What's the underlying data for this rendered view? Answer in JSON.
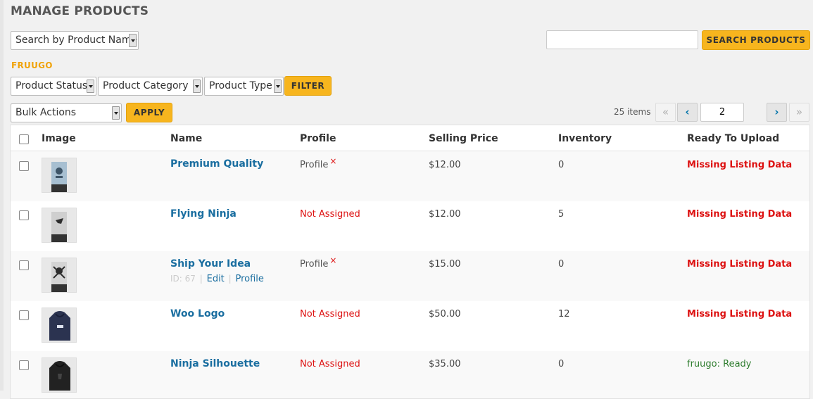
{
  "page": {
    "title": "MANAGE PRODUCTS"
  },
  "search": {
    "filter_by_label": "Search by Product Name",
    "input_value": "",
    "input_placeholder": "",
    "button_label": "SEARCH PRODUCTS"
  },
  "marketplace": "FRUUGO",
  "filters": {
    "status_label": "Product Status",
    "category_label": "Product Category",
    "type_label": "Product Type",
    "button_label": "FILTER"
  },
  "bulk": {
    "label": "Bulk Actions",
    "button_label": "APPLY"
  },
  "pagination": {
    "items_text": "25 items",
    "first": "«",
    "prev": "‹",
    "current_page": "2",
    "next": "›",
    "last": "»"
  },
  "table": {
    "columns": [
      "Image",
      "Name",
      "Profile",
      "Selling Price",
      "Inventory",
      "Ready To Upload"
    ],
    "rows": [
      {
        "name": "Premium Quality",
        "profile": "Profile",
        "profile_x": "×",
        "price": "$12.00",
        "inventory": "0",
        "status": "Missing Listing Data",
        "thumb_icon": "poster-icon"
      },
      {
        "name": "Flying Ninja",
        "profile": "Not Assigned",
        "price": "$12.00",
        "inventory": "5",
        "status": "Missing Listing Data",
        "thumb_icon": "poster-icon"
      },
      {
        "name": "Ship Your Idea",
        "profile": "Profile",
        "profile_x": "×",
        "price": "$15.00",
        "inventory": "0",
        "status": "Missing Listing Data",
        "thumb_icon": "poster-icon",
        "actions": {
          "id": "ID: 67",
          "sep": "|",
          "edit": "Edit",
          "profile": "Profile"
        }
      },
      {
        "name": "Woo Logo",
        "profile": "Not Assigned",
        "price": "$50.00",
        "inventory": "12",
        "status": "Missing Listing Data",
        "thumb_icon": "hoodie-icon"
      },
      {
        "name": "Ninja Silhouette",
        "profile": "Not Assigned",
        "price": "$35.00",
        "inventory": "0",
        "status": "fruugo: Ready",
        "thumb_icon": "hoodie-icon"
      }
    ]
  },
  "colors": {
    "accent_button": "#f7b51e",
    "link": "#1a6ea0",
    "error": "#dd1111",
    "success": "#2e7d2e",
    "marketplace": "#f0a30a"
  }
}
